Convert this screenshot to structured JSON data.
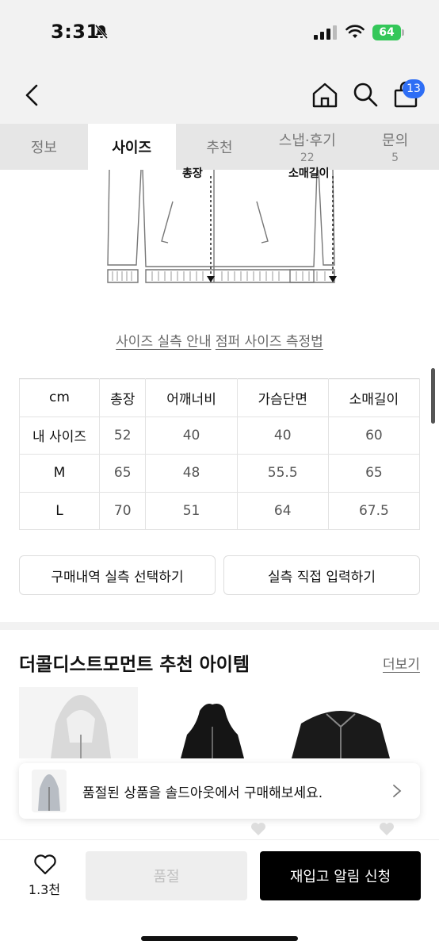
{
  "status": {
    "time": "3:31",
    "battery": "64"
  },
  "nav": {
    "cart_count": "13"
  },
  "tabs": [
    {
      "label": "정보",
      "count": ""
    },
    {
      "label": "사이즈",
      "count": ""
    },
    {
      "label": "추천",
      "count": ""
    },
    {
      "label": "스냅·후기",
      "count": "22"
    },
    {
      "label": "문의",
      "count": "5"
    }
  ],
  "illustration": {
    "length_label": "총장",
    "sleeve_label": "소매길이"
  },
  "guide": {
    "size_guide_link": "사이즈 실측 안내",
    "jumper_measure_link": "점퍼 사이즈 측정법"
  },
  "size_table": {
    "headers": [
      "cm",
      "총장",
      "어깨너비",
      "가슴단면",
      "소매길이"
    ],
    "rows": [
      [
        "내 사이즈",
        "52",
        "40",
        "40",
        "60"
      ],
      [
        "M",
        "65",
        "48",
        "55.5",
        "65"
      ],
      [
        "L",
        "70",
        "51",
        "64",
        "67.5"
      ]
    ]
  },
  "measure": {
    "select_history": "구매내역 실측 선택하기",
    "direct_input": "실측 직접 입력하기"
  },
  "recommend": {
    "title": "더콜디스트모먼트 추천 아이템",
    "more": "더보기"
  },
  "toast": {
    "message": "품절된 상품을 솔드아웃에서 구매해보세요."
  },
  "bottom": {
    "like_count": "1.3천",
    "soldout_label": "품절",
    "restock_label": "재입고 알림 신청"
  },
  "colors": {
    "accent_blue": "#2e6ef5",
    "battery_green": "#34c759"
  }
}
